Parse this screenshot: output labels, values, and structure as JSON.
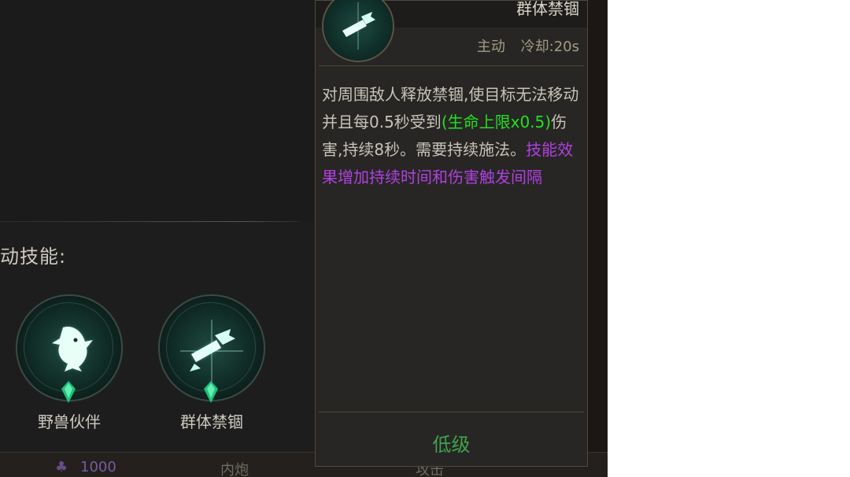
{
  "left": {
    "section_label": "动技能:",
    "skills": [
      {
        "name": "野兽伙伴",
        "icon": "eagle-icon"
      },
      {
        "name": "群体禁锢",
        "icon": "shackle-icon"
      }
    ]
  },
  "popup": {
    "title": "群体禁锢",
    "type": "主动",
    "cooldown": "冷却:20s",
    "desc_part1": "对周围敌人释放禁锢,使目标无法移动并且每0.5秒受到",
    "desc_green": "(生命上限x0.5)",
    "desc_part2": "伤害,持续8秒。需要持续施法。",
    "desc_purple": "技能效果增加持续时间和伤害触发间隔",
    "grade": "低级"
  },
  "bottom_bar": {
    "left_value": "1000",
    "tab1": "内炮",
    "tab2": "攻击"
  },
  "colors": {
    "green_text": "#22e022",
    "purple_text": "#b040e0",
    "grade": "#3fa34d"
  }
}
